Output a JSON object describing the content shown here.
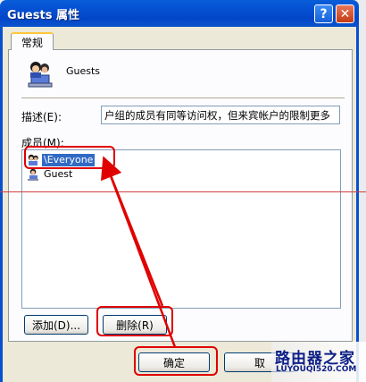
{
  "window": {
    "title": "Guests 属性",
    "help_symbol": "?",
    "close_symbol": "✕"
  },
  "tabs": [
    {
      "label": "常规"
    }
  ],
  "group": {
    "name": "Guests",
    "icon": "user-group-icon"
  },
  "description": {
    "label": "描述(E):",
    "value": "户组的成员有同等访问权，但来宾帐户的限制更多"
  },
  "members": {
    "label": "成员(M):",
    "items": [
      {
        "name": "\\Everyone",
        "icon": "user-group-icon",
        "selected": true
      },
      {
        "name": "Guest",
        "icon": "user-icon",
        "selected": false
      }
    ]
  },
  "buttons": {
    "add": "添加(D)...",
    "remove": "删除(R)",
    "ok": "确定",
    "cancel": "取"
  },
  "watermark": {
    "name": "路由器之家",
    "url": "LUYOUQI520.COM"
  },
  "annotations": {
    "color": "#e00000"
  }
}
